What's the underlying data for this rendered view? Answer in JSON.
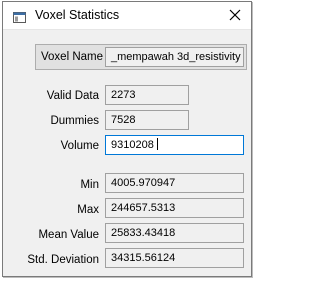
{
  "window": {
    "title": "Voxel Statistics"
  },
  "voxel_name": {
    "label": "Voxel Name",
    "value": "_mempawah 3d_resistivity"
  },
  "stats": {
    "valid_data": {
      "label": "Valid Data",
      "value": "2273"
    },
    "dummies": {
      "label": "Dummies",
      "value": "7528"
    },
    "volume": {
      "label": "Volume",
      "value": "9310208"
    },
    "min": {
      "label": "Min",
      "value": "4005.970947"
    },
    "max": {
      "label": "Max",
      "value": "244657.5313"
    },
    "mean": {
      "label": "Mean Value",
      "value": "25833.43418"
    },
    "std": {
      "label": "Std. Deviation",
      "value": "34315.56124"
    }
  },
  "icons": {
    "app": "window-app-icon",
    "close": "close-icon"
  }
}
